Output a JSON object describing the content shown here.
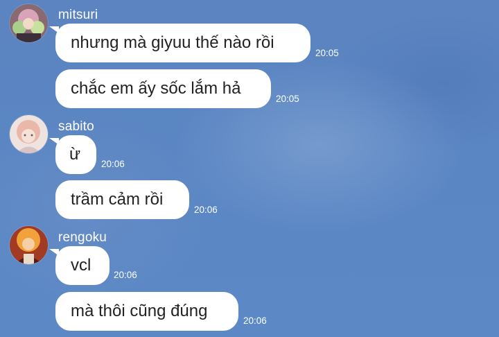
{
  "messages": [
    {
      "sender": "mitsuri",
      "text": "nhưng mà giyuu thế nào rồi",
      "time": "20:05"
    },
    {
      "sender": "mitsuri",
      "text": "chắc em ấy sốc lắm hả",
      "time": "20:05"
    },
    {
      "sender": "sabito",
      "text": "ừ",
      "time": "20:06"
    },
    {
      "sender": "sabito",
      "text": "trầm cảm rồi",
      "time": "20:06"
    },
    {
      "sender": "rengoku",
      "text": "vcl",
      "time": "20:06"
    },
    {
      "sender": "rengoku",
      "text": "mà thôi cũng đúng",
      "time": "20:06"
    }
  ],
  "colors": {
    "background": "#5b86c3",
    "bubble": "#ffffff",
    "text": "#222222",
    "meta": "#ffffff"
  }
}
